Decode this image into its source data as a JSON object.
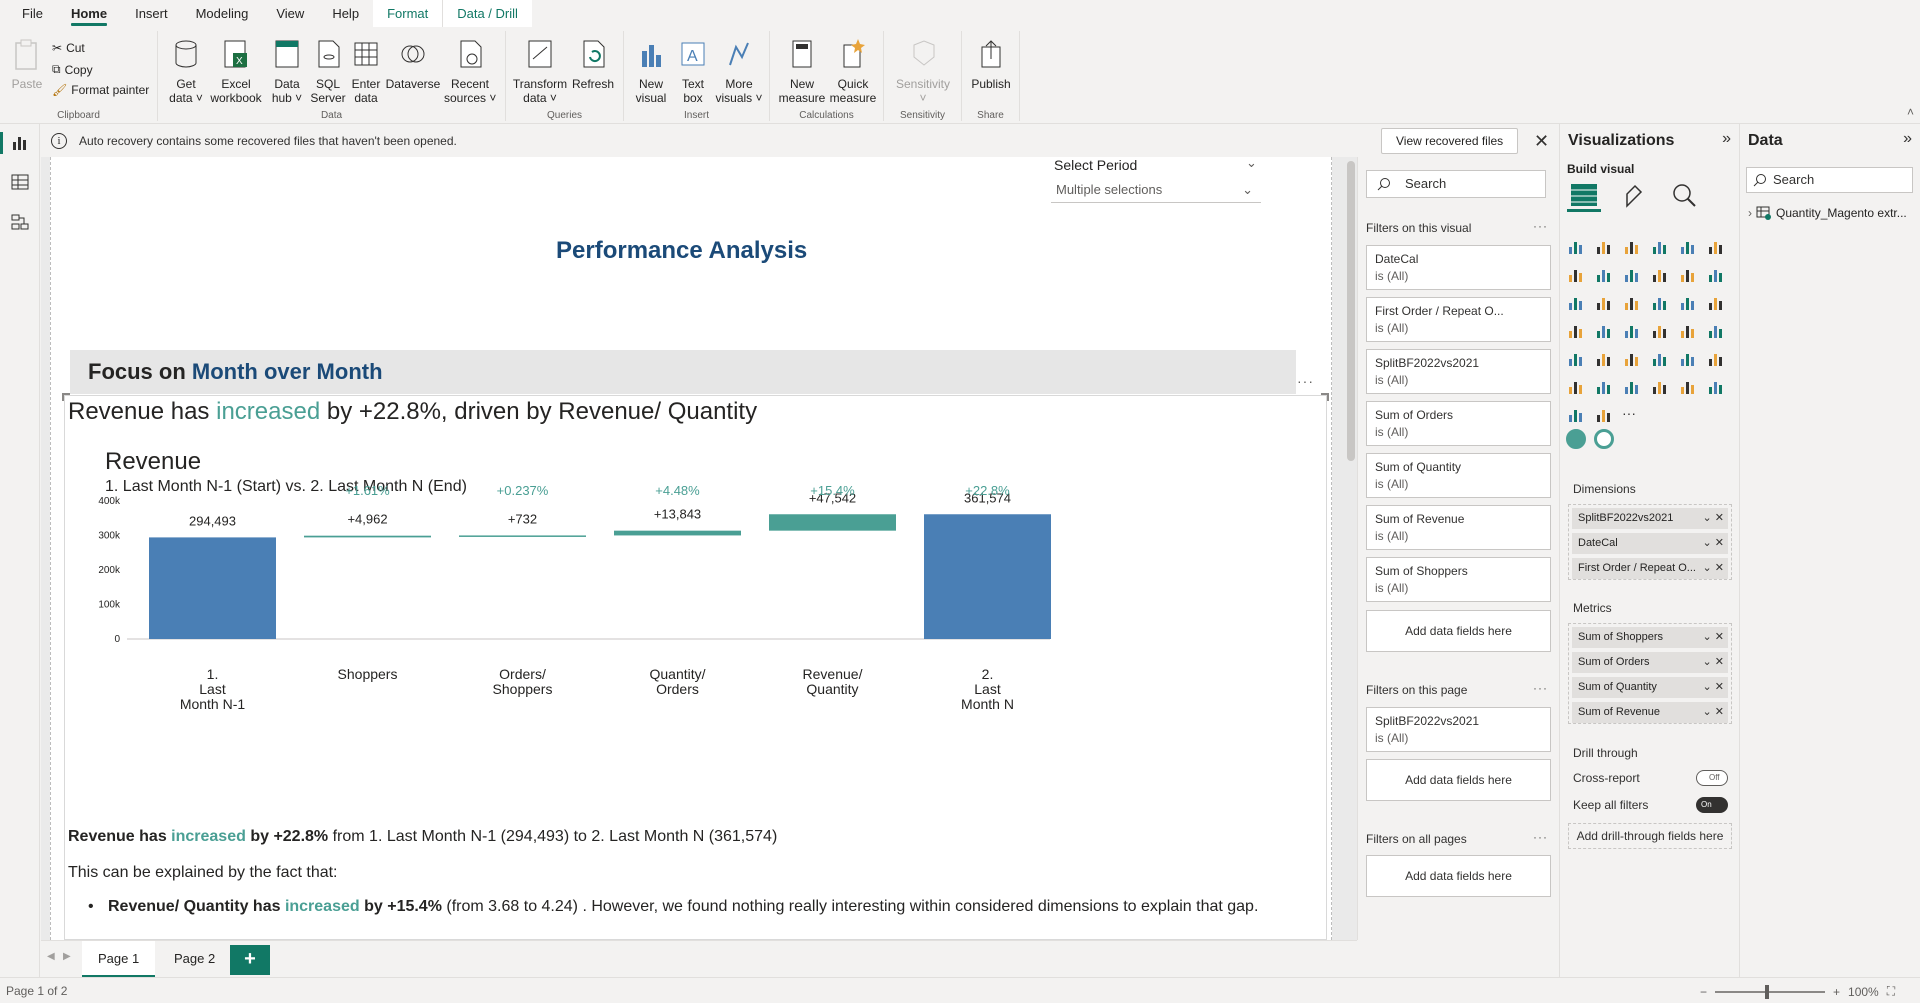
{
  "menu": {
    "items": [
      "File",
      "Home",
      "Insert",
      "Modeling",
      "View",
      "Help",
      "Format",
      "Data / Drill"
    ]
  },
  "ribbon": {
    "clipboard": {
      "paste": "Paste",
      "cut": "Cut",
      "copy": "Copy",
      "format_painter": "Format painter",
      "label": "Clipboard"
    },
    "data": {
      "get_data": "Get\ndata ˅",
      "excel": "Excel\nworkbook",
      "data_hub": "Data\nhub ˅",
      "sql": "SQL\nServer",
      "enter": "Enter\ndata",
      "dataverse": "Dataverse",
      "recent": "Recent\nsources ˅",
      "label": "Data"
    },
    "queries": {
      "transform": "Transform\ndata ˅",
      "refresh": "Refresh",
      "label": "Queries"
    },
    "insert": {
      "new_visual": "New\nvisual",
      "text_box": "Text\nbox",
      "more_visuals": "More\nvisuals ˅",
      "label": "Insert"
    },
    "calculations": {
      "new_measure": "New\nmeasure",
      "quick_measure": "Quick\nmeasure",
      "label": "Calculations"
    },
    "sensitivity": {
      "sensitivity": "Sensitivity\n˅",
      "label": "Sensitivity"
    },
    "share": {
      "publish": "Publish",
      "label": "Share"
    }
  },
  "notification": {
    "message": "Auto recovery contains some recovered files that haven't been opened.",
    "button": "View recovered files"
  },
  "report": {
    "slicer_label": "Select Period",
    "slicer_value": "Multiple selections",
    "title": "Performance Analysis",
    "focus_prefix": "Focus on ",
    "focus_highlight": "Month over Month",
    "headline_a": "Revenue has ",
    "headline_b": "increased",
    "headline_c": " by +22.8%, driven by Revenue/ Quantity",
    "summary_a": "Revenue has ",
    "summary_b": "increased",
    "summary_c": " by +22.8%",
    "summary_d": " from 1. Last Month N-1 (294,493) to 2. Last Month N (361,574)",
    "explain": "This can be explained by the fact that:",
    "bullet_a": "Revenue/ Quantity has ",
    "bullet_b": "increased",
    "bullet_c": " by +15.4%",
    "bullet_d": " (from 3.68 to 4.24) . However, we found nothing really interesting within considered dimensions to explain that gap."
  },
  "chart_data": {
    "type": "bar",
    "title": "Revenue",
    "subtitle": "1. Last Month N-1 (Start) vs. 2. Last Month N (End)",
    "categories": [
      "1.\nLast\nMonth N-1",
      "Shoppers",
      "Orders/\nShoppers",
      "Quantity/\nOrders",
      "Revenue/\nQuantity",
      "2.\nLast\nMonth N"
    ],
    "kind": [
      "total",
      "delta",
      "delta",
      "delta",
      "delta",
      "total"
    ],
    "values": [
      294493,
      4962,
      732,
      13843,
      47542,
      361574
    ],
    "value_labels": [
      "294,493",
      "+4,962",
      "+732",
      "+13,843",
      "+47,542",
      "361,574"
    ],
    "pct_labels": [
      "",
      "+1.61%",
      "+0.237%",
      "+4.48%",
      "+15.4%",
      "+22.8%"
    ],
    "yticks": [
      "0",
      "100k",
      "200k",
      "300k",
      "400k"
    ],
    "ylim": [
      0,
      400000
    ],
    "colors": {
      "total": "#4a7fb5",
      "delta": "#4a9f94",
      "pct": "#4a9f94"
    }
  },
  "filters": {
    "search_placeholder": "Search",
    "on_visual_label": "Filters on this visual",
    "visual_cards": [
      {
        "name": "DateCal",
        "value": "is (All)"
      },
      {
        "name": "First Order / Repeat O...",
        "value": "is (All)"
      },
      {
        "name": "SplitBF2022vs2021",
        "value": "is (All)"
      },
      {
        "name": "Sum of Orders",
        "value": "is (All)"
      },
      {
        "name": "Sum of Quantity",
        "value": "is (All)"
      },
      {
        "name": "Sum of Revenue",
        "value": "is (All)"
      },
      {
        "name": "Sum of Shoppers",
        "value": "is (All)"
      }
    ],
    "add_fields": "Add data fields here",
    "on_page_label": "Filters on this page",
    "page_cards": [
      {
        "name": "SplitBF2022vs2021",
        "value": "is (All)"
      }
    ],
    "all_pages_label": "Filters on all pages"
  },
  "viz": {
    "title": "Visualizations",
    "build_visual": "Build visual",
    "dimensions_label": "Dimensions",
    "dimensions": [
      "SplitBF2022vs2021",
      "DateCal",
      "First Order / Repeat O..."
    ],
    "metrics_label": "Metrics",
    "metrics": [
      "Sum of Shoppers",
      "Sum of Orders",
      "Sum of Quantity",
      "Sum of Revenue"
    ],
    "drill_label": "Drill through",
    "cross_report": "Cross-report",
    "cross_report_state": "Off",
    "keep_filters": "Keep all filters",
    "keep_filters_state": "On",
    "drill_add": "Add drill-through fields here"
  },
  "data_pane": {
    "title": "Data",
    "search_placeholder": "Search",
    "table": "Quantity_Magento extr..."
  },
  "pages": {
    "tabs": [
      "Page 1",
      "Page 2"
    ],
    "add": "+"
  },
  "status": {
    "page": "Page 1 of 2",
    "zoom": "100%"
  }
}
